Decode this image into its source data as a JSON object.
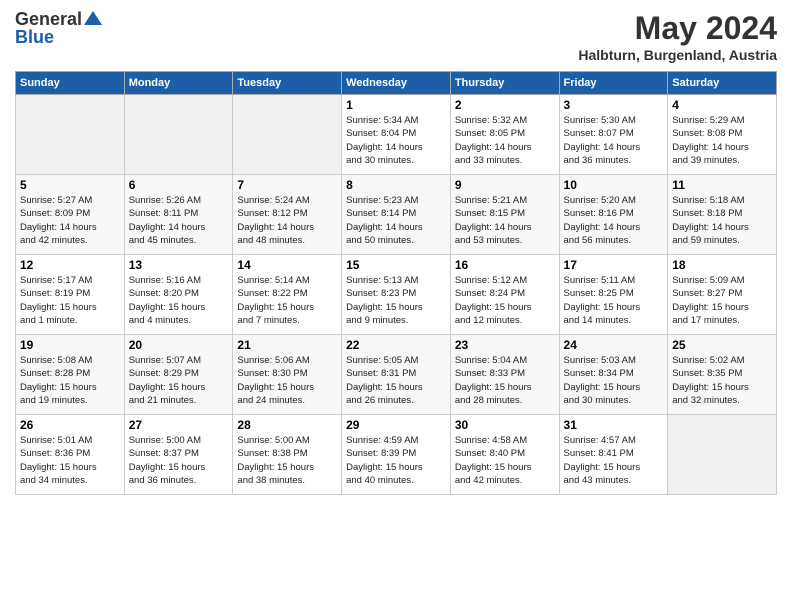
{
  "logo": {
    "general": "General",
    "blue": "Blue"
  },
  "title": "May 2024",
  "subtitle": "Halbturn, Burgenland, Austria",
  "days_of_week": [
    "Sunday",
    "Monday",
    "Tuesday",
    "Wednesday",
    "Thursday",
    "Friday",
    "Saturday"
  ],
  "weeks": [
    [
      {
        "day": "",
        "info": ""
      },
      {
        "day": "",
        "info": ""
      },
      {
        "day": "",
        "info": ""
      },
      {
        "day": "1",
        "info": "Sunrise: 5:34 AM\nSunset: 8:04 PM\nDaylight: 14 hours\nand 30 minutes."
      },
      {
        "day": "2",
        "info": "Sunrise: 5:32 AM\nSunset: 8:05 PM\nDaylight: 14 hours\nand 33 minutes."
      },
      {
        "day": "3",
        "info": "Sunrise: 5:30 AM\nSunset: 8:07 PM\nDaylight: 14 hours\nand 36 minutes."
      },
      {
        "day": "4",
        "info": "Sunrise: 5:29 AM\nSunset: 8:08 PM\nDaylight: 14 hours\nand 39 minutes."
      }
    ],
    [
      {
        "day": "5",
        "info": "Sunrise: 5:27 AM\nSunset: 8:09 PM\nDaylight: 14 hours\nand 42 minutes."
      },
      {
        "day": "6",
        "info": "Sunrise: 5:26 AM\nSunset: 8:11 PM\nDaylight: 14 hours\nand 45 minutes."
      },
      {
        "day": "7",
        "info": "Sunrise: 5:24 AM\nSunset: 8:12 PM\nDaylight: 14 hours\nand 48 minutes."
      },
      {
        "day": "8",
        "info": "Sunrise: 5:23 AM\nSunset: 8:14 PM\nDaylight: 14 hours\nand 50 minutes."
      },
      {
        "day": "9",
        "info": "Sunrise: 5:21 AM\nSunset: 8:15 PM\nDaylight: 14 hours\nand 53 minutes."
      },
      {
        "day": "10",
        "info": "Sunrise: 5:20 AM\nSunset: 8:16 PM\nDaylight: 14 hours\nand 56 minutes."
      },
      {
        "day": "11",
        "info": "Sunrise: 5:18 AM\nSunset: 8:18 PM\nDaylight: 14 hours\nand 59 minutes."
      }
    ],
    [
      {
        "day": "12",
        "info": "Sunrise: 5:17 AM\nSunset: 8:19 PM\nDaylight: 15 hours\nand 1 minute."
      },
      {
        "day": "13",
        "info": "Sunrise: 5:16 AM\nSunset: 8:20 PM\nDaylight: 15 hours\nand 4 minutes."
      },
      {
        "day": "14",
        "info": "Sunrise: 5:14 AM\nSunset: 8:22 PM\nDaylight: 15 hours\nand 7 minutes."
      },
      {
        "day": "15",
        "info": "Sunrise: 5:13 AM\nSunset: 8:23 PM\nDaylight: 15 hours\nand 9 minutes."
      },
      {
        "day": "16",
        "info": "Sunrise: 5:12 AM\nSunset: 8:24 PM\nDaylight: 15 hours\nand 12 minutes."
      },
      {
        "day": "17",
        "info": "Sunrise: 5:11 AM\nSunset: 8:25 PM\nDaylight: 15 hours\nand 14 minutes."
      },
      {
        "day": "18",
        "info": "Sunrise: 5:09 AM\nSunset: 8:27 PM\nDaylight: 15 hours\nand 17 minutes."
      }
    ],
    [
      {
        "day": "19",
        "info": "Sunrise: 5:08 AM\nSunset: 8:28 PM\nDaylight: 15 hours\nand 19 minutes."
      },
      {
        "day": "20",
        "info": "Sunrise: 5:07 AM\nSunset: 8:29 PM\nDaylight: 15 hours\nand 21 minutes."
      },
      {
        "day": "21",
        "info": "Sunrise: 5:06 AM\nSunset: 8:30 PM\nDaylight: 15 hours\nand 24 minutes."
      },
      {
        "day": "22",
        "info": "Sunrise: 5:05 AM\nSunset: 8:31 PM\nDaylight: 15 hours\nand 26 minutes."
      },
      {
        "day": "23",
        "info": "Sunrise: 5:04 AM\nSunset: 8:33 PM\nDaylight: 15 hours\nand 28 minutes."
      },
      {
        "day": "24",
        "info": "Sunrise: 5:03 AM\nSunset: 8:34 PM\nDaylight: 15 hours\nand 30 minutes."
      },
      {
        "day": "25",
        "info": "Sunrise: 5:02 AM\nSunset: 8:35 PM\nDaylight: 15 hours\nand 32 minutes."
      }
    ],
    [
      {
        "day": "26",
        "info": "Sunrise: 5:01 AM\nSunset: 8:36 PM\nDaylight: 15 hours\nand 34 minutes."
      },
      {
        "day": "27",
        "info": "Sunrise: 5:00 AM\nSunset: 8:37 PM\nDaylight: 15 hours\nand 36 minutes."
      },
      {
        "day": "28",
        "info": "Sunrise: 5:00 AM\nSunset: 8:38 PM\nDaylight: 15 hours\nand 38 minutes."
      },
      {
        "day": "29",
        "info": "Sunrise: 4:59 AM\nSunset: 8:39 PM\nDaylight: 15 hours\nand 40 minutes."
      },
      {
        "day": "30",
        "info": "Sunrise: 4:58 AM\nSunset: 8:40 PM\nDaylight: 15 hours\nand 42 minutes."
      },
      {
        "day": "31",
        "info": "Sunrise: 4:57 AM\nSunset: 8:41 PM\nDaylight: 15 hours\nand 43 minutes."
      },
      {
        "day": "",
        "info": ""
      }
    ]
  ]
}
